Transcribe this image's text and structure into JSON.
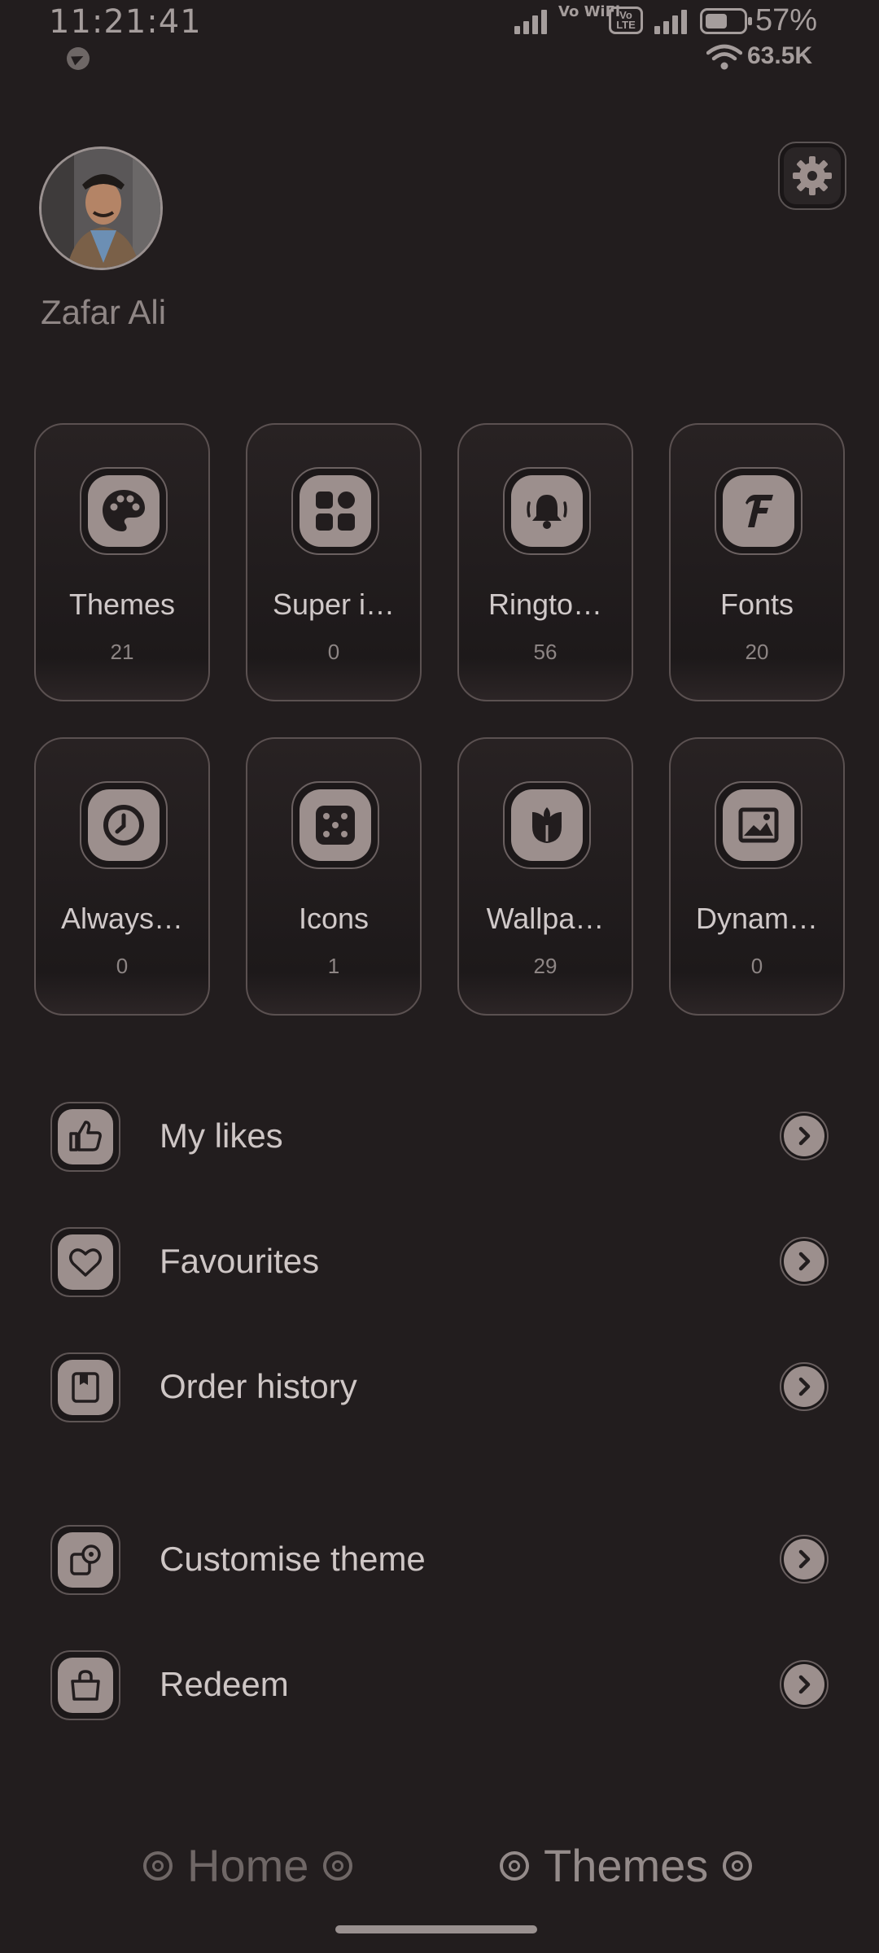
{
  "status_bar": {
    "time": "11:21:41",
    "vo_wifi": "Vo WiFi",
    "vo_lte": "Vo LTE",
    "battery_percent": "57%",
    "net_speed": "63.5K",
    "icons": [
      "telegram-icon",
      "signal-icon",
      "vowifi-icon",
      "volte-icon",
      "battery-icon",
      "wifi-icon"
    ]
  },
  "profile": {
    "name": "Zafar Ali"
  },
  "categories": [
    {
      "label": "Themes",
      "count": "21",
      "icon": "palette-icon"
    },
    {
      "label": "Super i…",
      "count": "0",
      "icon": "super-icons-icon"
    },
    {
      "label": "Ringto…",
      "count": "56",
      "icon": "bell-icon"
    },
    {
      "label": "Fonts",
      "count": "20",
      "icon": "font-icon"
    },
    {
      "label": "Always…",
      "count": "0",
      "icon": "clock-icon"
    },
    {
      "label": "Icons",
      "count": "1",
      "icon": "dice-icon"
    },
    {
      "label": "Wallpa…",
      "count": "29",
      "icon": "tulip-icon"
    },
    {
      "label": "Dynam…",
      "count": "0",
      "icon": "image-icon"
    }
  ],
  "menu": [
    {
      "label": "My likes",
      "icon": "thumbs-up-icon"
    },
    {
      "label": "Favourites",
      "icon": "heart-icon"
    },
    {
      "label": "Order history",
      "icon": "order-icon"
    },
    {
      "label": "Customise theme",
      "icon": "customise-icon"
    },
    {
      "label": "Redeem",
      "icon": "bag-icon"
    }
  ],
  "bottom_nav": {
    "home": "Home",
    "themes": "Themes",
    "active": "themes"
  },
  "colors": {
    "background": "#221d1e",
    "icon_fill": "#9c8f8d",
    "text": "#cfc7c6",
    "muted": "#8d8584"
  }
}
